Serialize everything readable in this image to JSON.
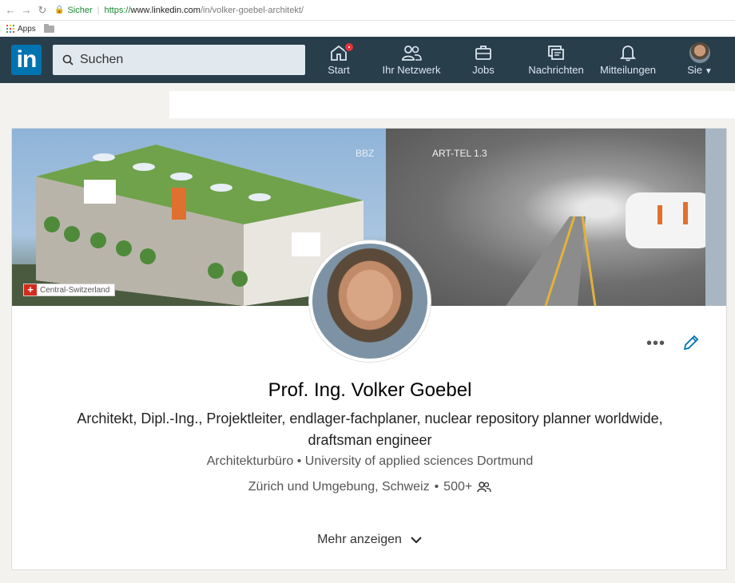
{
  "browser": {
    "secure_label": "Sicher",
    "url_scheme": "https://",
    "url_host": "www.linkedin.com",
    "url_path": "/in/volker-goebel-architekt/",
    "bookmarks": {
      "apps_label": "Apps"
    }
  },
  "header": {
    "logo_text": "in",
    "search_placeholder": "Suchen",
    "nav": [
      {
        "label": "Start",
        "icon": "home-icon",
        "badge": true
      },
      {
        "label": "Ihr Netzwerk",
        "icon": "network-icon"
      },
      {
        "label": "Jobs",
        "icon": "briefcase-icon"
      },
      {
        "label": "Nachrichten",
        "icon": "messages-icon"
      },
      {
        "label": "Mitteilungen",
        "icon": "bell-icon"
      },
      {
        "label": "Sie",
        "icon": "avatar"
      }
    ]
  },
  "banner": {
    "left_label": "BBZ",
    "right_label": "ART-TEL 1.3",
    "flag_label": "Central-Switzerland"
  },
  "profile": {
    "name": "Prof. Ing. Volker Goebel",
    "headline": "Architekt, Dipl.-Ing., Projektleiter, endlager-fachplaner, nuclear repository planner worldwide, draftsman engineer",
    "company": "Architekturbüro",
    "school": "University of applied sciences Dortmund",
    "location": "Zürich und Umgebung, Schweiz",
    "connections": "500+",
    "separator": "•",
    "more_label": "Mehr anzeigen"
  },
  "colors": {
    "header_bg": "#283e4a",
    "brand": "#0073b1",
    "badge": "#e0363a"
  }
}
